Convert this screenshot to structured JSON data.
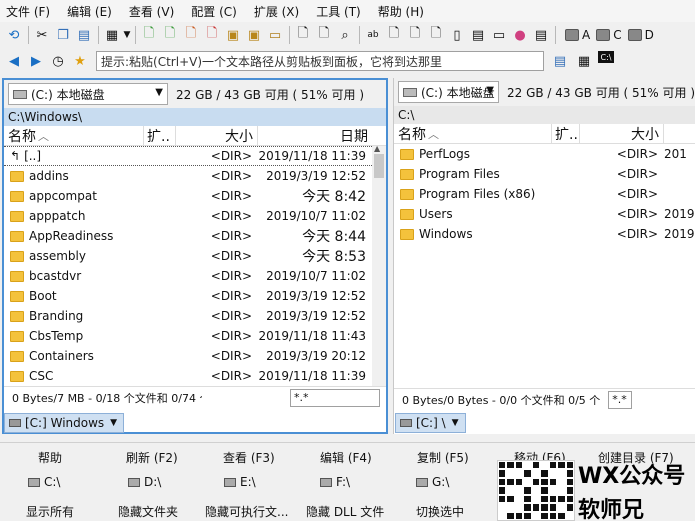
{
  "menu": [
    "文件 (F)",
    "编辑 (E)",
    "查看 (V)",
    "配置 (C)",
    "扩展 (X)",
    "工具 (T)",
    "帮助 (H)"
  ],
  "toolbar": {
    "drives": [
      "A",
      "C",
      "D"
    ]
  },
  "nav": {
    "hint": "提示:粘贴(Ctrl+V)一个文本路径从剪贴板到面板，它将到达那里"
  },
  "left_panel": {
    "drive": "(C:) 本地磁盘",
    "space": "22 GB / 43 GB 可用 ( 51% 可用 )",
    "path": "C:\\Windows\\",
    "columns": [
      "名称",
      "扩..",
      "大小",
      "日期"
    ],
    "rows": [
      {
        "name": "[..]",
        "size": "<DIR>",
        "date": "2019/11/18 11:39",
        "parent": true
      },
      {
        "name": "addins",
        "size": "<DIR>",
        "date": "2019/3/19 12:52"
      },
      {
        "name": "appcompat",
        "size": "<DIR>",
        "date": "今天 8:42",
        "today": true
      },
      {
        "name": "apppatch",
        "size": "<DIR>",
        "date": "2019/10/7 11:02"
      },
      {
        "name": "AppReadiness",
        "size": "<DIR>",
        "date": "今天 8:44",
        "today": true
      },
      {
        "name": "assembly",
        "size": "<DIR>",
        "date": "今天 8:53",
        "today": true
      },
      {
        "name": "bcastdvr",
        "size": "<DIR>",
        "date": "2019/10/7 11:02"
      },
      {
        "name": "Boot",
        "size": "<DIR>",
        "date": "2019/3/19 12:52"
      },
      {
        "name": "Branding",
        "size": "<DIR>",
        "date": "2019/3/19 12:52"
      },
      {
        "name": "CbsTemp",
        "size": "<DIR>",
        "date": "2019/11/18 11:43"
      },
      {
        "name": "Containers",
        "size": "<DIR>",
        "date": "2019/3/19 20:12"
      },
      {
        "name": "CSC",
        "size": "<DIR>",
        "date": "2019/11/18 11:39"
      }
    ],
    "status": "0 Bytes/7 MB - 0/18 个文件和 0/74 个",
    "filter": "*.*",
    "tab": "[C:] Windows"
  },
  "right_panel": {
    "drive": "(C:) 本地磁盘",
    "space": "22 GB / 43 GB 可用 ( 51% 可用 )",
    "path": "C:\\",
    "columns": [
      "名称",
      "扩..",
      "大小"
    ],
    "rows": [
      {
        "name": "PerfLogs",
        "size": "<DIR>",
        "date": "201"
      },
      {
        "name": "Program Files",
        "size": "<DIR>",
        "date": ""
      },
      {
        "name": "Program Files (x86)",
        "size": "<DIR>",
        "date": ""
      },
      {
        "name": "Users",
        "size": "<DIR>",
        "date": "2019"
      },
      {
        "name": "Windows",
        "size": "<DIR>",
        "date": "2019"
      }
    ],
    "status": "0 Bytes/0 Bytes - 0/0 个文件和 0/5 个",
    "filter": "*.*",
    "tab": "[C:] \\"
  },
  "fkeys": {
    "row1": [
      "帮助",
      "刷新 (F2)",
      "查看 (F3)",
      "编辑 (F4)",
      "复制 (F5)",
      "移动 (F6)",
      "创建目录 (F7)"
    ],
    "row2": [
      "C:\\",
      "D:\\",
      "E:\\",
      "F:\\",
      "G:\\"
    ],
    "row3": [
      "显示所有",
      "隐藏文件夹",
      "隐藏可执行文...",
      "隐藏 DLL 文件",
      "切换选中"
    ]
  },
  "watermark": {
    "line1": "WX公众号",
    "line2": "软师兄"
  }
}
